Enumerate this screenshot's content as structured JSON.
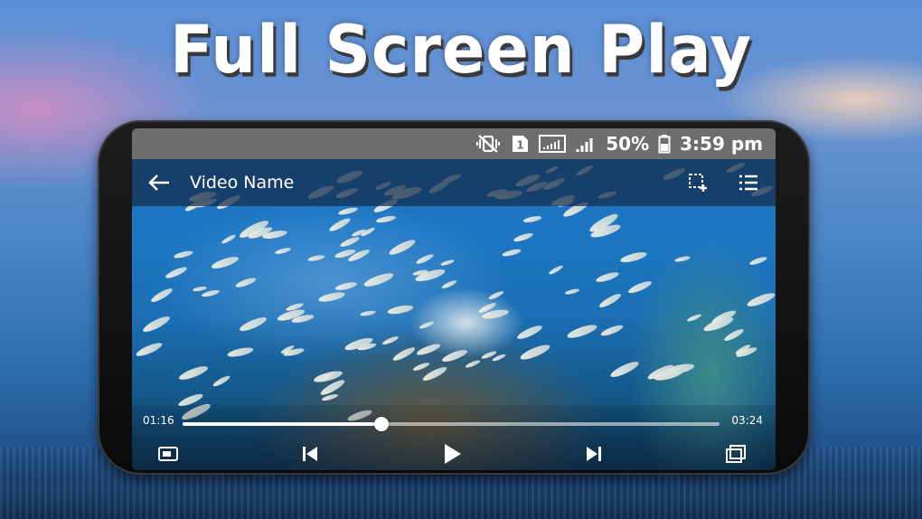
{
  "promo": {
    "headline": "Full Screen Play"
  },
  "status_bar": {
    "battery": "50%",
    "time": "3:59 pm",
    "sim_badge": "1",
    "icons": [
      "mute-vibrate-icon",
      "sim-icon",
      "signal-box-icon",
      "signal-bars-icon",
      "battery-icon"
    ]
  },
  "player": {
    "title": "Video Name",
    "elapsed": "01:16",
    "duration": "03:24",
    "progress_fraction": 0.37,
    "top_actions": [
      "crop-add-icon",
      "playlist-icon"
    ],
    "controls": [
      "screen-mode-icon",
      "previous-icon",
      "play-icon",
      "next-icon",
      "popup-window-icon"
    ]
  },
  "colors": {
    "status_bar": "#6e6e6e",
    "text": "#ffffff"
  }
}
